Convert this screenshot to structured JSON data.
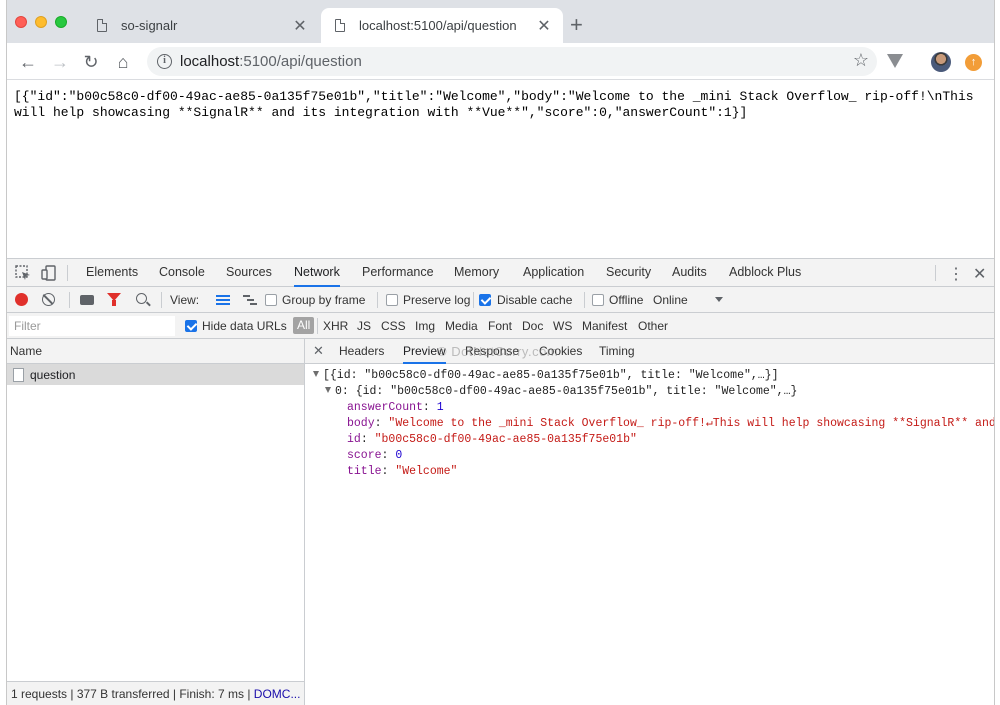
{
  "browser": {
    "tabs": [
      {
        "title": "so-signalr",
        "active": false
      },
      {
        "title": "localhost:5100/api/question",
        "active": true
      }
    ],
    "new_tab_label": "+",
    "address": {
      "host": "localhost",
      "rest": ":5100/api/question"
    }
  },
  "page": {
    "raw_json": "[{\"id\":\"b00c58c0-df00-49ac-ae85-0a135f75e01b\",\"title\":\"Welcome\",\"body\":\"Welcome to the _mini Stack Overflow_ rip-off!\\nThis will help showcasing **SignalR** and its integration with **Vue**\",\"score\":0,\"answerCount\":1}]"
  },
  "devtools": {
    "panels": [
      "Elements",
      "Console",
      "Sources",
      "Network",
      "Performance",
      "Memory",
      "Application",
      "Security",
      "Audits",
      "Adblock Plus"
    ],
    "active_panel": "Network",
    "network_toolbar": {
      "view_label": "View:",
      "group_by_frame": {
        "label": "Group by frame",
        "checked": false
      },
      "preserve_log": {
        "label": "Preserve log",
        "checked": false
      },
      "disable_cache": {
        "label": "Disable cache",
        "checked": true
      },
      "offline": {
        "label": "Offline",
        "checked": false
      },
      "throttle": "Online"
    },
    "filter_bar": {
      "placeholder": "Filter",
      "hide_data_urls": {
        "label": "Hide data URLs",
        "checked": true
      },
      "types": [
        "All",
        "XHR",
        "JS",
        "CSS",
        "Img",
        "Media",
        "Font",
        "Doc",
        "WS",
        "Manifest",
        "Other"
      ]
    },
    "requests": {
      "column_name": "Name",
      "rows": [
        {
          "name": "question"
        }
      ]
    },
    "status_bar": {
      "summary": "1 requests | 377 B transferred | Finish: 7 ms | ",
      "dom": "DOMC..."
    },
    "detail": {
      "tabs": [
        "Headers",
        "Preview",
        "Response",
        "Cookies",
        "Timing"
      ],
      "active_tab": "Preview",
      "watermark": "© DotNetCurry.com",
      "preview": {
        "array_summary": "[{id: \"b00c58c0-df00-49ac-ae85-0a135f75e01b\", title: \"Welcome\",…}]",
        "item_summary": "0: {id: \"b00c58c0-df00-49ac-ae85-0a135f75e01b\", title: \"Welcome\",…}",
        "props": [
          {
            "key": "answerCount",
            "value": "1",
            "type": "num"
          },
          {
            "key": "body",
            "value": "\"Welcome to the _mini Stack Overflow_ rip-off!↵This will help showcasing **SignalR** and its",
            "type": "str"
          },
          {
            "key": "id",
            "value": "\"b00c58c0-df00-49ac-ae85-0a135f75e01b\"",
            "type": "str"
          },
          {
            "key": "score",
            "value": "0",
            "type": "num"
          },
          {
            "key": "title",
            "value": "\"Welcome\"",
            "type": "str"
          }
        ]
      }
    }
  }
}
